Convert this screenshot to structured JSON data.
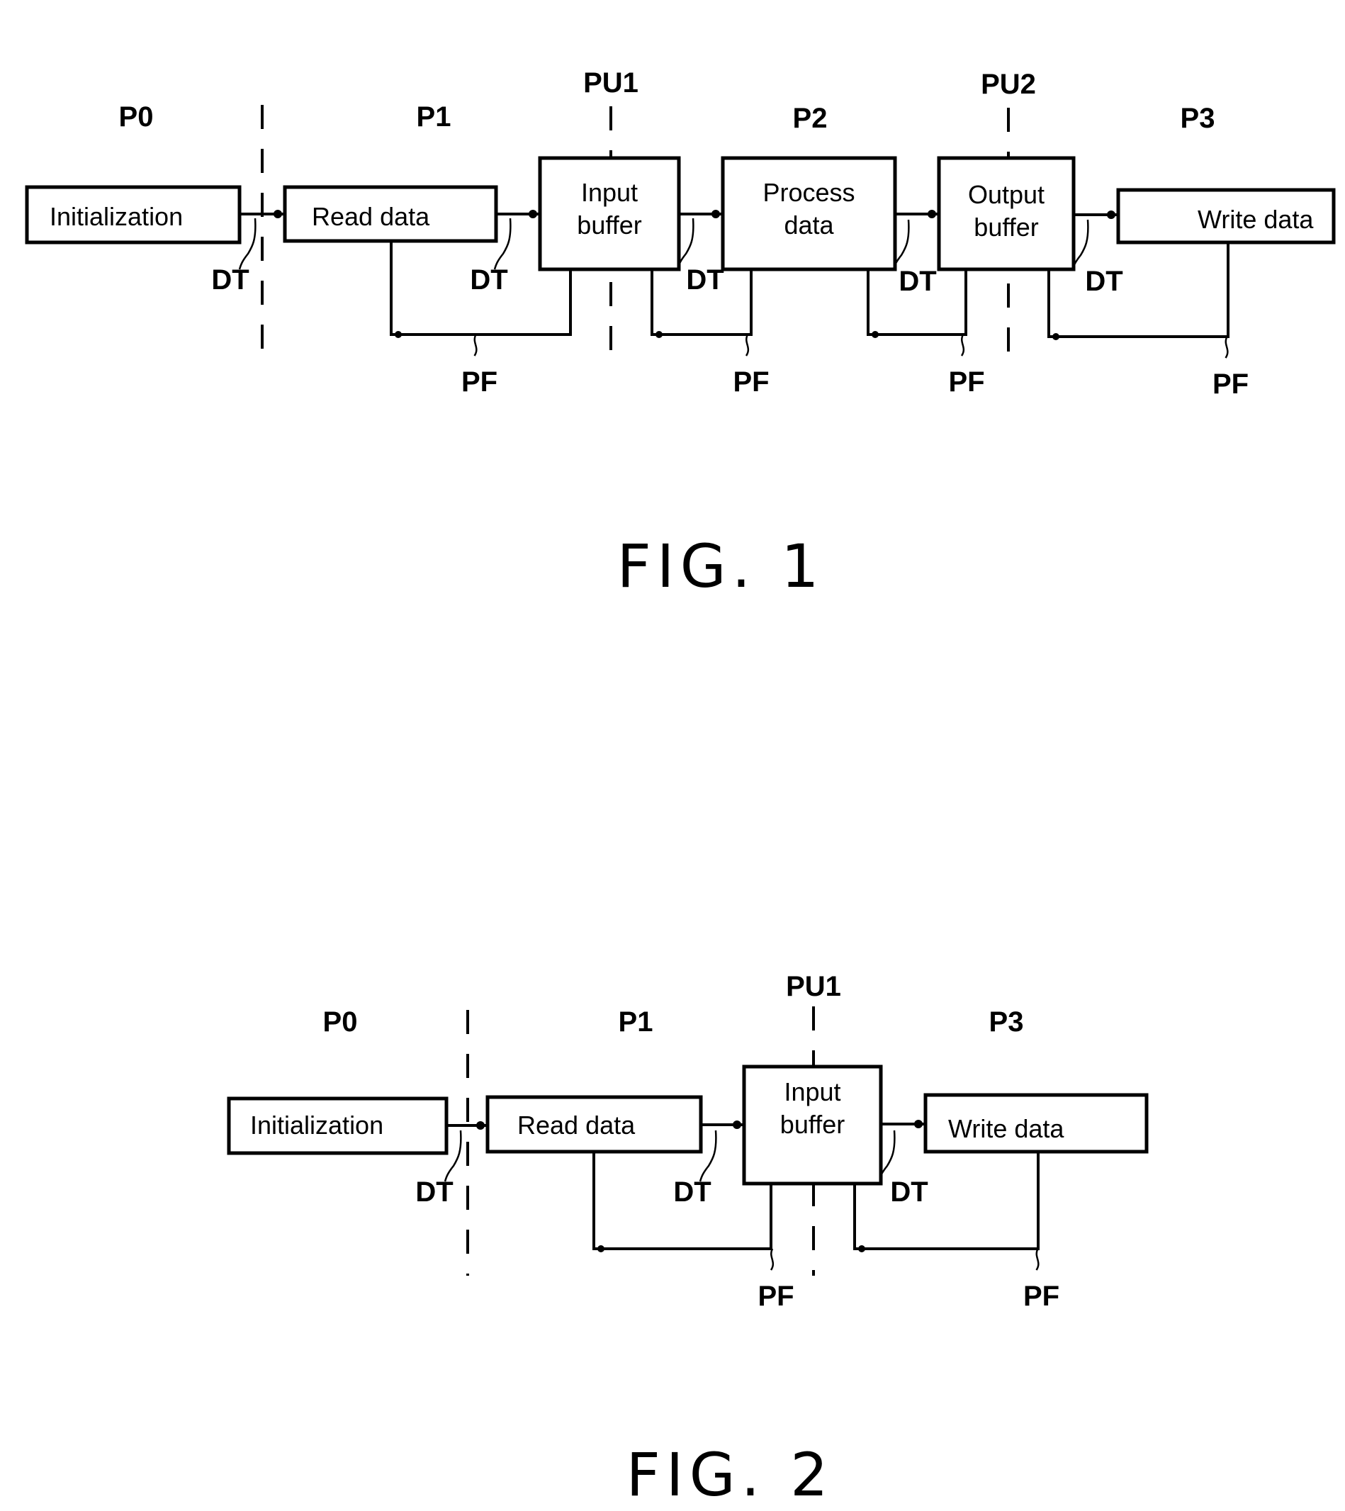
{
  "figures": [
    {
      "caption": "FIG. 1",
      "phases": [
        "P0",
        "P1",
        "P2",
        "P3"
      ],
      "processing_units": [
        "PU1",
        "PU2"
      ],
      "blocks": [
        {
          "id": "init",
          "lines": [
            "Initialization"
          ]
        },
        {
          "id": "read",
          "lines": [
            "Read data"
          ]
        },
        {
          "id": "inbuf",
          "lines": [
            "Input",
            "buffer"
          ]
        },
        {
          "id": "process",
          "lines": [
            "Process",
            "data"
          ]
        },
        {
          "id": "outbuf",
          "lines": [
            "Output",
            "buffer"
          ]
        },
        {
          "id": "write",
          "lines": [
            "Write data"
          ]
        }
      ],
      "transfer_label": "DT",
      "feedback_label": "PF"
    },
    {
      "caption": "FIG. 2",
      "phases": [
        "P0",
        "P1",
        "P3"
      ],
      "processing_units": [
        "PU1"
      ],
      "blocks": [
        {
          "id": "init",
          "lines": [
            "Initialization"
          ]
        },
        {
          "id": "read",
          "lines": [
            "Read data"
          ]
        },
        {
          "id": "inbuf",
          "lines": [
            "Input",
            "buffer"
          ]
        },
        {
          "id": "write",
          "lines": [
            "Write data"
          ]
        }
      ],
      "transfer_label": "DT",
      "feedback_label": "PF"
    }
  ]
}
